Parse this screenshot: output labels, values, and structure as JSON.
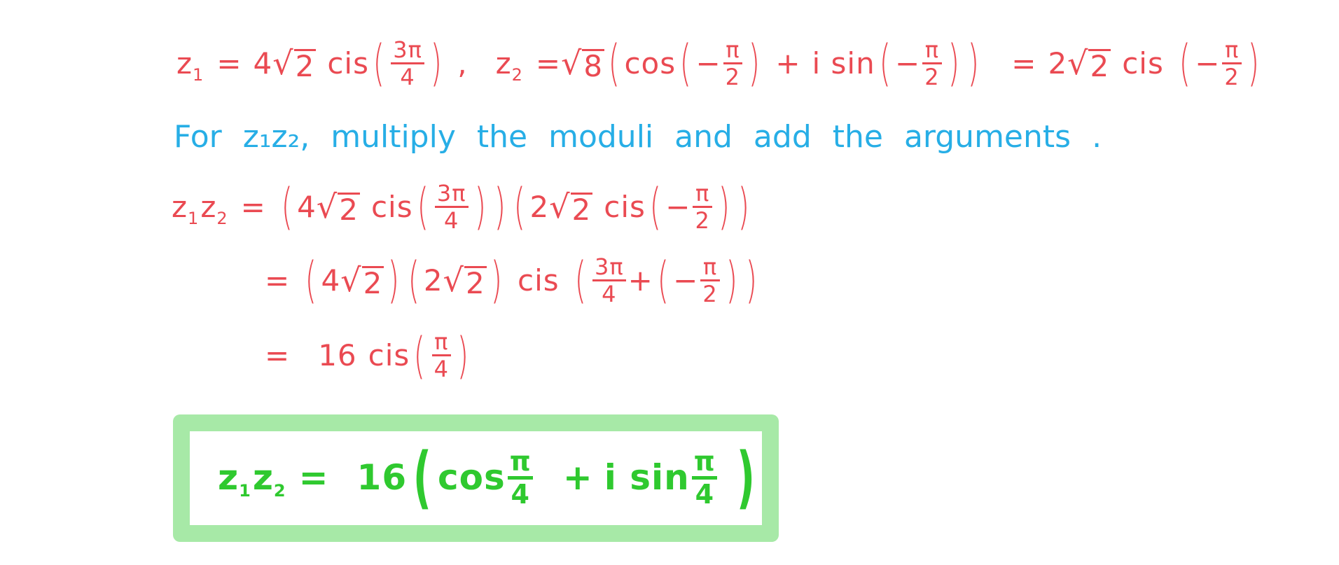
{
  "colors": {
    "working": "#ea4a52",
    "explanation": "#27aee6",
    "answer": "#2fc92f",
    "answer_box_border": "#a7e9a7"
  },
  "line1": {
    "z1_var": "z",
    "z1_sub": "1",
    "eq": "=",
    "z1_coef": "4",
    "z1_root": "2",
    "cis": "cis",
    "z1_arg_num": "3π",
    "z1_arg_den": "4",
    "comma": ",",
    "z2_var": "z",
    "z2_sub": "2",
    "z2_root": "8",
    "cos": "cos",
    "minus": "−",
    "z2_arg_num": "π",
    "z2_arg_den": "2",
    "plus": "+",
    "i_sin": "i sin",
    "z2_polar_coef": "2",
    "z2_polar_root": "2"
  },
  "explanation": {
    "words": [
      "For",
      "z₁z₂,",
      "multiply",
      "the",
      "moduli",
      "and",
      "add",
      "the",
      "arguments",
      "."
    ]
  },
  "working": {
    "product_lhs_var1": "z",
    "product_lhs_sub1": "1",
    "product_lhs_var2": "z",
    "product_lhs_sub2": "2",
    "step1": {
      "a_coef": "4",
      "a_root": "2",
      "cis": "cis",
      "a_num": "3π",
      "a_den": "4",
      "b_coef": "2",
      "b_root": "2",
      "b_num": "π",
      "b_den": "2"
    },
    "step2": {
      "a_coef": "4",
      "a_root": "2",
      "b_coef": "2",
      "b_root": "2",
      "cis": "cis",
      "arg1_num": "3π",
      "arg1_den": "4",
      "plus": "+",
      "arg2_num": "π",
      "arg2_den": "2"
    },
    "step3": {
      "modulus": "16",
      "cis": "cis",
      "arg_num": "π",
      "arg_den": "4"
    }
  },
  "answer": {
    "var1": "z",
    "sub1": "1",
    "var2": "z",
    "sub2": "2",
    "eq": "=",
    "modulus": "16",
    "cos": "cos",
    "cos_num": "π",
    "cos_den": "4",
    "plus": "+",
    "i_sin": "i sin",
    "sin_num": "π",
    "sin_den": "4"
  }
}
